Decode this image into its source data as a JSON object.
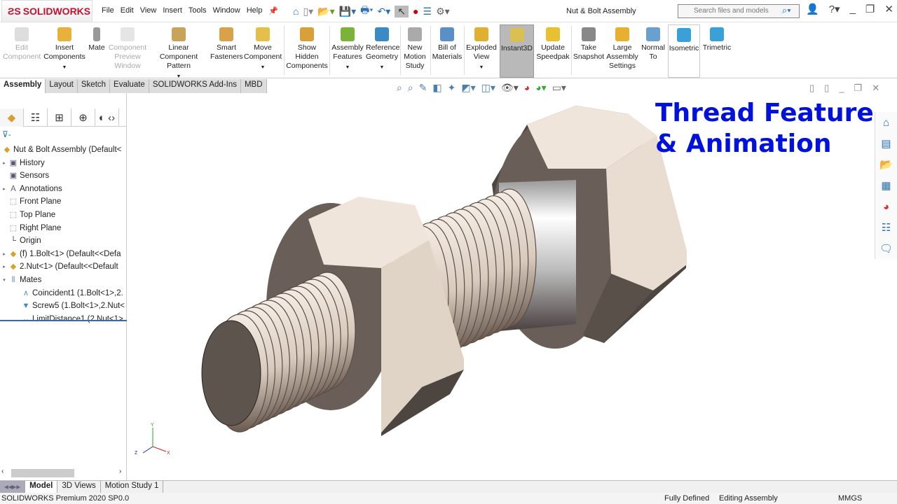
{
  "app": {
    "logo": "SOLIDWORKS",
    "document_title": "Nut & Bolt Assembly"
  },
  "menu": [
    "File",
    "Edit",
    "View",
    "Insert",
    "Tools",
    "Window",
    "Help"
  ],
  "search": {
    "placeholder": "Search files and models"
  },
  "ribbon": [
    {
      "label": "Edit Component",
      "disabled": true
    },
    {
      "label": "Insert Components"
    },
    {
      "label": "Mate"
    },
    {
      "label": "Component Preview Window",
      "disabled": true
    },
    {
      "label": "Linear Component Pattern"
    },
    {
      "label": "Smart Fasteners"
    },
    {
      "label": "Move Component"
    },
    {
      "label": "Show Hidden Components"
    },
    {
      "label": "Assembly Features"
    },
    {
      "label": "Reference Geometry"
    },
    {
      "label": "New Motion Study"
    },
    {
      "label": "Bill of Materials"
    },
    {
      "label": "Exploded View"
    },
    {
      "label": "Instant3D",
      "active": true
    },
    {
      "label": "Update Speedpak"
    },
    {
      "label": "Take Snapshot"
    },
    {
      "label": "Large Assembly Settings"
    },
    {
      "label": "Normal To"
    },
    {
      "label": "Isometric",
      "selected": true
    },
    {
      "label": "Trimetric"
    }
  ],
  "tabs": [
    "Assembly",
    "Layout",
    "Sketch",
    "Evaluate",
    "SOLIDWORKS Add-Ins",
    "MBD"
  ],
  "tree": [
    {
      "label": "Nut & Bolt Assembly  (Default<",
      "icon": "assembly",
      "level": 0
    },
    {
      "label": "History",
      "icon": "folder",
      "level": 1,
      "expand": true
    },
    {
      "label": "Sensors",
      "icon": "folder",
      "level": 1
    },
    {
      "label": "Annotations",
      "icon": "annotation",
      "level": 1,
      "expand": true
    },
    {
      "label": "Front Plane",
      "icon": "plane",
      "level": 1
    },
    {
      "label": "Top Plane",
      "icon": "plane",
      "level": 1
    },
    {
      "label": "Right Plane",
      "icon": "plane",
      "level": 1
    },
    {
      "label": "Origin",
      "icon": "origin",
      "level": 1
    },
    {
      "label": "(f) 1.Bolt<1> (Default<<Defa",
      "icon": "part",
      "level": 1,
      "expand": true
    },
    {
      "label": "2.Nut<1> (Default<<Default",
      "icon": "part",
      "level": 1,
      "expand": true
    },
    {
      "label": "Mates",
      "icon": "mates",
      "level": 1,
      "expanded": true
    },
    {
      "label": "Coincident1 (1.Bolt<1>,2.",
      "icon": "coincident",
      "level": 2
    },
    {
      "label": "Screw5 (1.Bolt<1>,2.Nut<",
      "icon": "screw",
      "level": 2
    },
    {
      "label": "LimitDistance1 (2.Nut<1>",
      "icon": "distance",
      "level": 2
    }
  ],
  "bottom_tabs": [
    "Model",
    "3D Views",
    "Motion Study 1"
  ],
  "status": {
    "version": "SOLIDWORKS Premium 2020 SP0.0",
    "state": "Fully Defined",
    "mode": "Editing Assembly",
    "units": "MMGS"
  },
  "overlay": {
    "line1": "Thread Feature",
    "line2": "& Animation"
  },
  "triad": {
    "x": "X",
    "y": "Y",
    "z": "Z"
  }
}
